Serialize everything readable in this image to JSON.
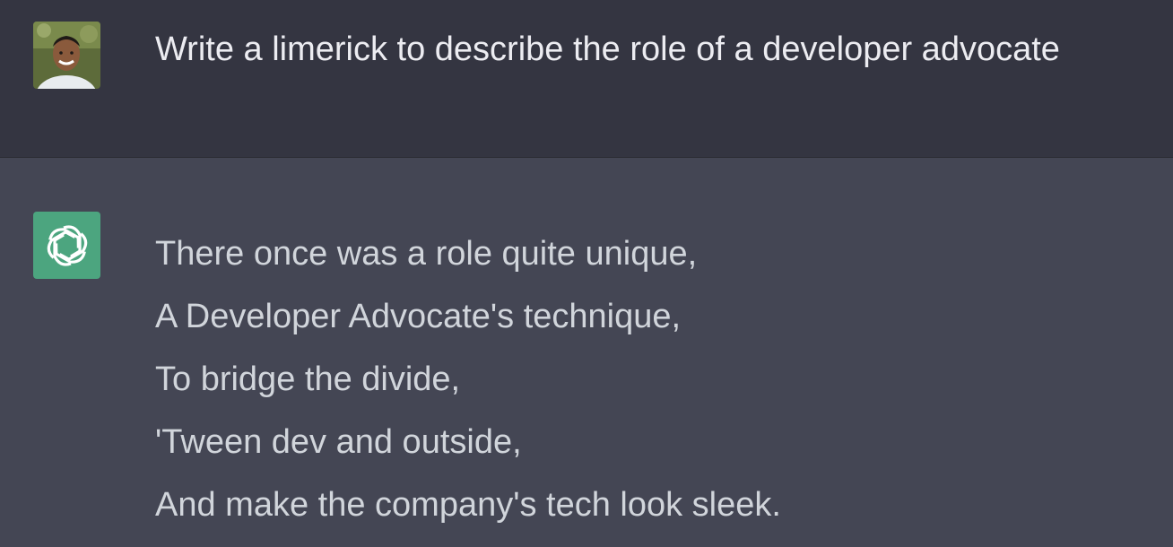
{
  "user_message": {
    "avatar": "user-photo-avatar",
    "text": "Write a limerick to describe the role of a developer advocate"
  },
  "assistant_message": {
    "avatar": "openai-logo-icon",
    "lines": [
      "There once was a role quite unique,",
      "A Developer Advocate's technique,",
      "To bridge the divide,",
      "'Tween dev and outside,",
      "And make the company's tech look sleek."
    ]
  },
  "colors": {
    "user_row_bg": "#343541",
    "assistant_row_bg": "#444654",
    "bot_avatar_bg": "#4ca57f",
    "text": "#d1d5db"
  }
}
